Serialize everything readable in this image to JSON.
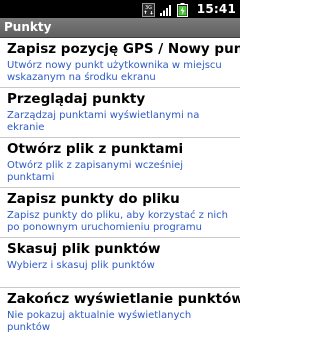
{
  "status_bar": {
    "time": "15:41",
    "icons": [
      "3g-data-icon",
      "signal-strength-icon",
      "battery-charging-icon"
    ]
  },
  "title_bar": {
    "title": "Punkty"
  },
  "menu": {
    "items": [
      {
        "title": "Zapisz pozycję GPS / Nowy punkt",
        "description": "Utwórz nowy punkt użytkownika w miejscu wskazanym na środku ekranu"
      },
      {
        "title": "Przeglądaj punkty",
        "description": "Zarządzaj punktami wyświetlanymi na ekranie"
      },
      {
        "title": "Otwórz plik z punktami",
        "description": "Otwórz plik z zapisanymi wcześniej punktami"
      },
      {
        "title": "Zapisz punkty do pliku",
        "description": "Zapisz punkty do pliku, aby korzystać z nich po ponownym uruchomieniu programu"
      },
      {
        "title": "Skasuj plik punktów",
        "description": "Wybierz i skasuj plik punktów"
      },
      {
        "title": "Zakończ wyświetlanie punktów",
        "description": "Nie pokazuj aktualnie wyświetlanych punktów"
      }
    ]
  },
  "colors": {
    "status_bar_bg": "#000000",
    "title_bar_bg": "#6b6b6b",
    "item_title": "#000000",
    "item_description": "#2e5bc6",
    "divider": "#c8c8c8",
    "battery_charge": "#4cc23b"
  }
}
